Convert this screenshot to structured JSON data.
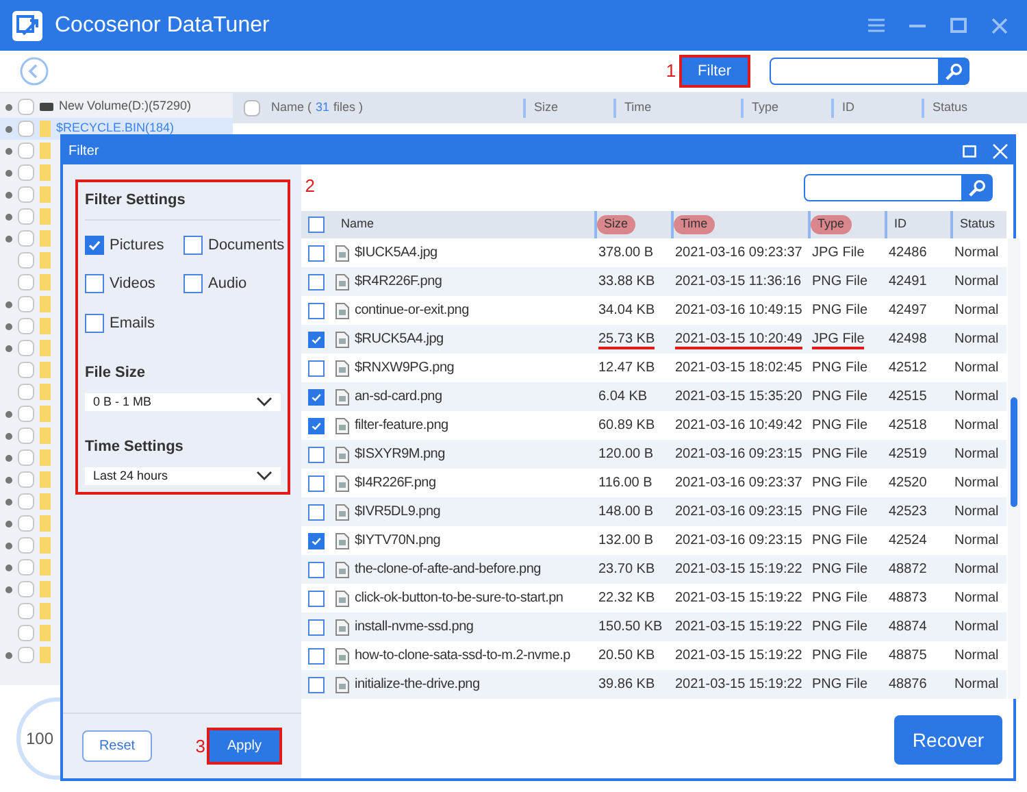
{
  "app": {
    "title": "Cocosenor DataTuner"
  },
  "toolbar": {
    "step_label": "1",
    "filter_button": "Filter"
  },
  "tree": {
    "items": [
      {
        "label": "New Volume(D:)(57290)",
        "expandable": true,
        "checked": false,
        "selected": false
      },
      {
        "label": "$RECYCLE.BIN(184)",
        "expandable": true,
        "checked": false,
        "selected": true
      },
      {
        "expandable": true,
        "checked": false
      },
      {
        "expandable": true,
        "checked": false
      },
      {
        "expandable": true,
        "checked": false
      },
      {
        "expandable": true,
        "checked": false
      },
      {
        "expandable": true,
        "checked": false
      },
      {
        "expandable": false,
        "checked": false
      },
      {
        "expandable": false,
        "checked": false
      },
      {
        "expandable": true,
        "checked": false
      },
      {
        "expandable": true,
        "checked": false
      },
      {
        "expandable": true,
        "checked": false
      },
      {
        "expandable": false,
        "checked": false
      },
      {
        "expandable": false,
        "checked": false
      },
      {
        "expandable": true,
        "checked": false
      },
      {
        "expandable": true,
        "checked": false
      },
      {
        "expandable": true,
        "checked": false
      },
      {
        "expandable": true,
        "checked": false
      },
      {
        "expandable": true,
        "checked": false
      },
      {
        "expandable": true,
        "checked": false
      },
      {
        "expandable": true,
        "checked": false
      },
      {
        "expandable": true,
        "checked": false
      },
      {
        "expandable": true,
        "checked": false
      },
      {
        "expandable": false,
        "checked": false
      },
      {
        "expandable": false,
        "checked": false
      },
      {
        "expandable": true,
        "checked": false
      }
    ]
  },
  "file_list": {
    "all_checked": false,
    "name_prefix": "Name (",
    "count": "31",
    "name_suffix": "files )",
    "columns": [
      "Size",
      "Time",
      "Type",
      "ID",
      "Status"
    ]
  },
  "progress": {
    "reading": "100"
  },
  "filter_dialog": {
    "title": "Filter",
    "all_checked": false,
    "settings": {
      "title": "Filter Settings",
      "step_label": "2",
      "types": [
        {
          "label": "Pictures",
          "checked": true
        },
        {
          "label": "Documents",
          "checked": false
        },
        {
          "label": "Videos",
          "checked": false
        },
        {
          "label": "Audio",
          "checked": false
        },
        {
          "label": "Emails",
          "checked": false
        }
      ],
      "file_size": {
        "label": "File Size",
        "value": "0 B - 1 MB"
      },
      "time": {
        "label": "Time Settings",
        "value": "Last 24 hours"
      }
    },
    "reset": "Reset",
    "apply_step_label": "3",
    "apply": "Apply",
    "columns": [
      {
        "label": "Name",
        "highlighted": false
      },
      {
        "label": "Size",
        "highlighted": true
      },
      {
        "label": "Time",
        "highlighted": true
      },
      {
        "label": "Type",
        "highlighted": true
      },
      {
        "label": "ID",
        "highlighted": false
      },
      {
        "label": "Status",
        "highlighted": false
      }
    ],
    "rows": [
      {
        "name": "$IUCK5A4.jpg",
        "size": "378.00 B",
        "time": "2021-03-16 09:23:37",
        "type": "JPG File",
        "id": "42486",
        "status": "Normal",
        "checked": false,
        "underlined": false
      },
      {
        "name": "$R4R226F.png",
        "size": "33.88 KB",
        "time": "2021-03-15 11:36:16",
        "type": "PNG File",
        "id": "42491",
        "status": "Normal",
        "checked": false,
        "underlined": false
      },
      {
        "name": "continue-or-exit.png",
        "size": "34.04 KB",
        "time": "2021-03-16 10:49:15",
        "type": "PNG File",
        "id": "42497",
        "status": "Normal",
        "checked": false,
        "underlined": false
      },
      {
        "name": "$RUCK5A4.jpg",
        "size": "25.73 KB",
        "time": "2021-03-15 10:20:49",
        "type": "JPG File",
        "id": "42498",
        "status": "Normal",
        "checked": true,
        "underlined": true
      },
      {
        "name": "$RNXW9PG.png",
        "size": "12.47 KB",
        "time": "2021-03-15 18:02:45",
        "type": "PNG File",
        "id": "42512",
        "status": "Normal",
        "checked": false,
        "underlined": false
      },
      {
        "name": "an-sd-card.png",
        "size": "6.04 KB",
        "time": "2021-03-15 15:35:20",
        "type": "PNG File",
        "id": "42515",
        "status": "Normal",
        "checked": true,
        "underlined": false
      },
      {
        "name": "filter-feature.png",
        "size": "60.89 KB",
        "time": "2021-03-16 10:49:42",
        "type": "PNG File",
        "id": "42518",
        "status": "Normal",
        "checked": true,
        "underlined": false
      },
      {
        "name": "$ISXYR9M.png",
        "size": "120.00 B",
        "time": "2021-03-16 09:23:15",
        "type": "PNG File",
        "id": "42519",
        "status": "Normal",
        "checked": false,
        "underlined": false
      },
      {
        "name": "$I4R226F.png",
        "size": "116.00 B",
        "time": "2021-03-16 09:23:37",
        "type": "PNG File",
        "id": "42520",
        "status": "Normal",
        "checked": false,
        "underlined": false
      },
      {
        "name": "$IVR5DL9.png",
        "size": "148.00 B",
        "time": "2021-03-16 09:23:15",
        "type": "PNG File",
        "id": "42523",
        "status": "Normal",
        "checked": false,
        "underlined": false
      },
      {
        "name": "$IYTV70N.png",
        "size": "132.00 B",
        "time": "2021-03-16 09:23:15",
        "type": "PNG File",
        "id": "42524",
        "status": "Normal",
        "checked": true,
        "underlined": false
      },
      {
        "name": "the-clone-of-afte-and-before.png",
        "size": "23.70 KB",
        "time": "2021-03-15 15:19:22",
        "type": "PNG File",
        "id": "48872",
        "status": "Normal",
        "checked": false,
        "underlined": false
      },
      {
        "name": "click-ok-button-to-be-sure-to-start.pn",
        "size": "22.32 KB",
        "time": "2021-03-15 15:19:22",
        "type": "PNG File",
        "id": "48873",
        "status": "Normal",
        "checked": false,
        "underlined": false
      },
      {
        "name": "install-nvme-ssd.png",
        "size": "150.50 KB",
        "time": "2021-03-15 15:19:22",
        "type": "PNG File",
        "id": "48874",
        "status": "Normal",
        "checked": false,
        "underlined": false
      },
      {
        "name": "how-to-clone-sata-ssd-to-m.2-nvme.p",
        "size": "20.50 KB",
        "time": "2021-03-15 15:19:22",
        "type": "PNG File",
        "id": "48875",
        "status": "Normal",
        "checked": false,
        "underlined": false
      },
      {
        "name": "initialize-the-drive.png",
        "size": "39.86 KB",
        "time": "2021-03-15 15:19:22",
        "type": "PNG File",
        "id": "48876",
        "status": "Normal",
        "checked": false,
        "underlined": false
      }
    ],
    "recover": "Recover"
  }
}
